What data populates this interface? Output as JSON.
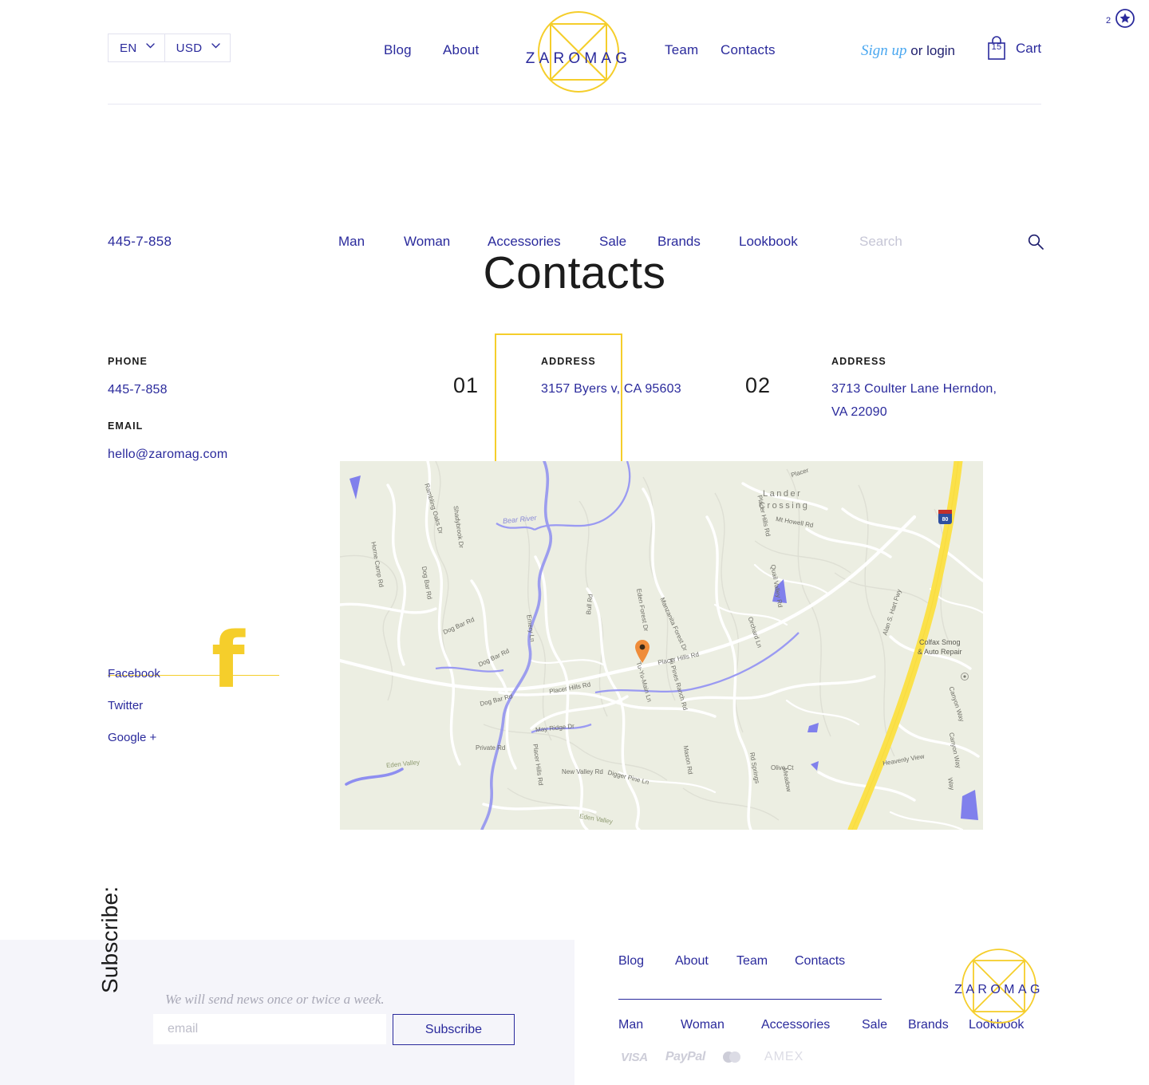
{
  "brand": {
    "name": "ZAROMAG",
    "yellow": "#f5ce2b",
    "navy": "#2a2a9c",
    "sky": "#49a7f0"
  },
  "header": {
    "language": {
      "value": "EN"
    },
    "currency": {
      "value": "USD"
    },
    "nav": [
      {
        "label": "Blog"
      },
      {
        "label": "About"
      },
      {
        "label": "Team"
      },
      {
        "label": "Contacts"
      }
    ],
    "account": {
      "signup": "Sign up",
      "or_login": " or login"
    },
    "cart": {
      "count": "15",
      "label": "Cart"
    },
    "favorites": {
      "count": "2"
    }
  },
  "subnav": {
    "phone": "445-7-858",
    "categories": [
      {
        "label": "Man"
      },
      {
        "label": "Woman"
      },
      {
        "label": "Accessories"
      },
      {
        "label": "Sale"
      },
      {
        "label": "Brands"
      },
      {
        "label": "Lookbook"
      }
    ],
    "search": {
      "placeholder": "Search",
      "value": ""
    }
  },
  "main": {
    "title": "Contacts",
    "phone": {
      "label": "PHONE",
      "value": "445-7-858"
    },
    "email": {
      "label": "EMAIL",
      "value": "hello@zaromag.com"
    },
    "addresses": [
      {
        "num": "01",
        "label": "ADDRESS",
        "value": "3157 Byers v, CA 95603"
      },
      {
        "num": "02",
        "label": "ADDRESS",
        "value": "3713 Coulter Lane Herndon, VA 22090"
      }
    ],
    "social": [
      {
        "label": "Facebook",
        "active": true
      },
      {
        "label": "Twitter",
        "active": false
      },
      {
        "label": "Google +",
        "active": false
      }
    ],
    "map": {
      "place_labels": [
        "Lander Crossing"
      ],
      "poi_labels": [
        "Colfax Smog\n& Auto Repair"
      ],
      "river_label": "Bear River",
      "highway_label": "Alan S. Hart Fwy",
      "highway_shield": "80",
      "road_labels": [
        "Rambling Oaks Dr",
        "Dog Bar Rd",
        "Shadybrook Dr",
        "Horne Camp Rd",
        "Emery Ln",
        "Bull Rd",
        "Eden Forest Dr",
        "Manzanita Forest Dr",
        "Placer Hills Rd",
        "Mt Howell Rd",
        "Quail Valley Rd",
        "Orchard Ln",
        "Tu-Yu-Main Ln",
        "Hi Pines Ranch Rd",
        "May Ridge Dr",
        "Private Rd",
        "New Valley Rd",
        "Digger Pine Ln",
        "Eden Valley",
        "Canyon Way",
        "Heavenly View",
        "Meadow",
        "Olive Ct",
        "Placer"
      ]
    }
  },
  "footer": {
    "subscribe_vertical": "Subscribe:",
    "note": "We will send news once or twice a week.",
    "email_placeholder": "email",
    "email_value": "",
    "button": "Subscribe",
    "nav_top": [
      {
        "label": "Blog"
      },
      {
        "label": "About"
      },
      {
        "label": "Team"
      },
      {
        "label": "Contacts"
      }
    ],
    "nav_bottom": [
      {
        "label": "Man"
      },
      {
        "label": "Woman"
      },
      {
        "label": "Accessories"
      },
      {
        "label": "Sale"
      },
      {
        "label": "Brands"
      },
      {
        "label": "Lookbook"
      }
    ],
    "payments": [
      {
        "label": "VISA"
      },
      {
        "label": "PayPal"
      },
      {
        "label": "mastercard"
      },
      {
        "label": "AMEX"
      }
    ]
  }
}
